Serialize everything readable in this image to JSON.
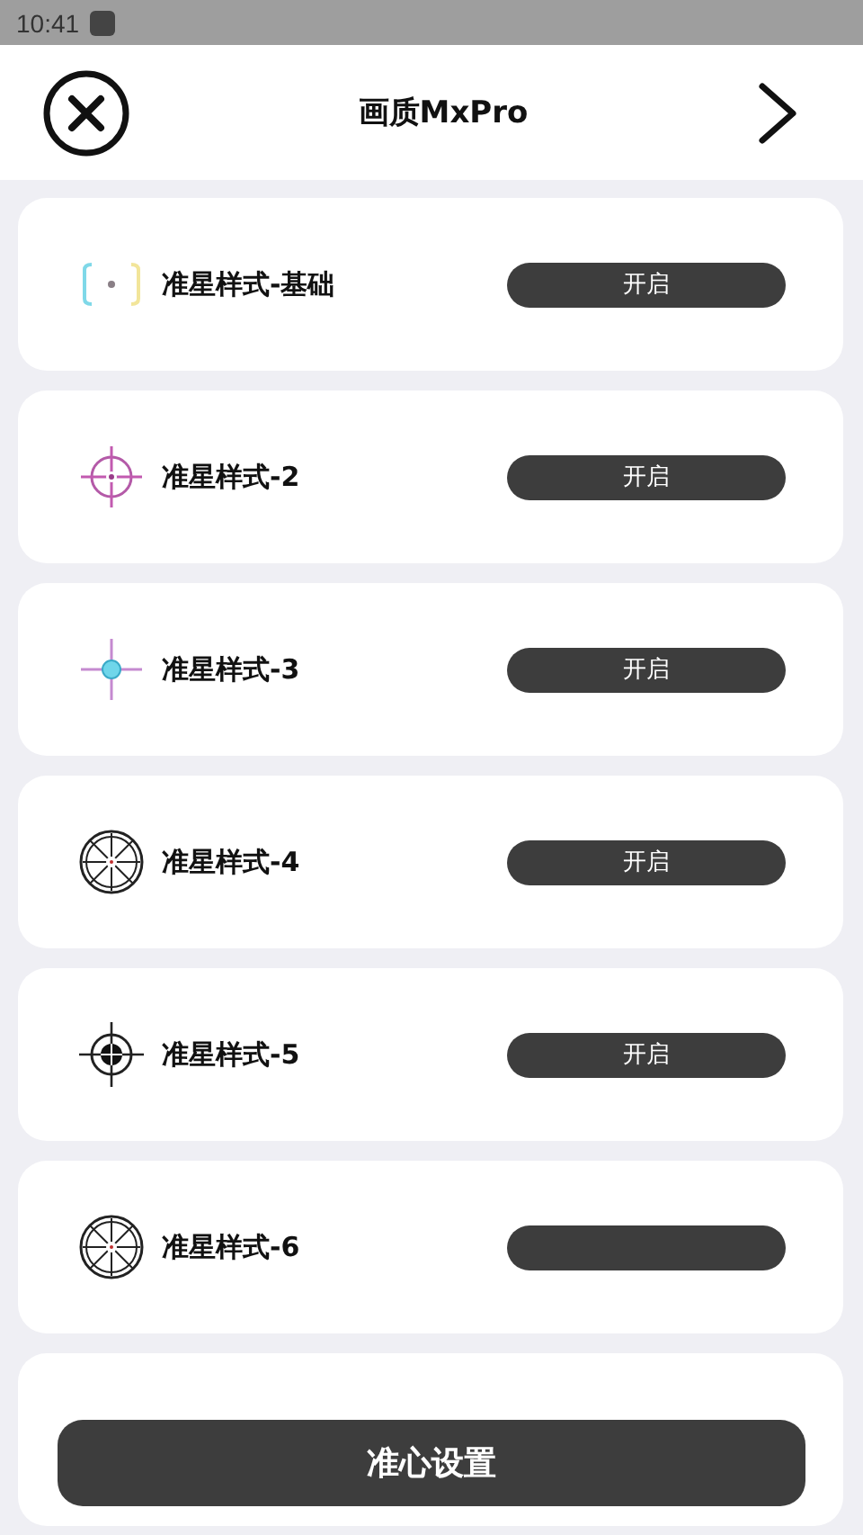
{
  "status_bar": {
    "time": "10:41"
  },
  "header": {
    "title": "画质MxPro"
  },
  "items": [
    {
      "kind": "bracket",
      "name": "准星样式-基础",
      "button": "开启"
    },
    {
      "kind": "circle-cross",
      "name": "准星样式-2",
      "button": "开启"
    },
    {
      "kind": "dot-cross",
      "name": "准星样式-3",
      "button": "开启"
    },
    {
      "kind": "wheel",
      "name": "准星样式-4",
      "button": "开启"
    },
    {
      "kind": "bullseye",
      "name": "准星样式-5",
      "button": "开启"
    },
    {
      "kind": "wheel",
      "name": "准星样式-6"
    },
    {
      "kind": "blank"
    }
  ],
  "bottom_button": "准心设置"
}
